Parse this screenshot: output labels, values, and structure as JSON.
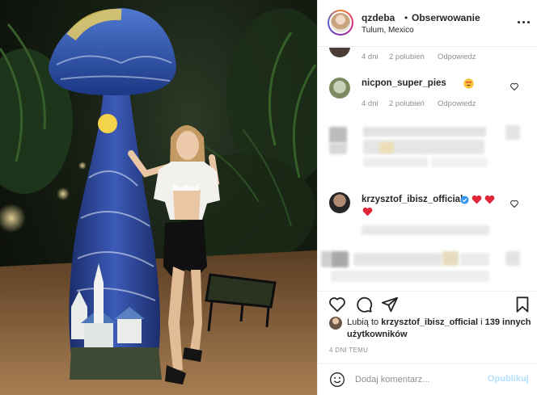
{
  "post": {
    "username": "qzdeba",
    "separator": "•",
    "follow_label": "Obserwowanie",
    "location": "Tulum, Mexico"
  },
  "comments": [
    {
      "meta": {
        "age": "4 dni",
        "likes": "2 polubień",
        "reply": "Odpowiedz"
      }
    },
    {
      "username": "nicpon_super_pies",
      "emoji": "heart-eyes-emoji",
      "meta": {
        "age": "4 dni",
        "likes": "2 polubień",
        "reply": "Odpowiedz"
      }
    },
    {
      "username": "krzysztof_ibisz_official",
      "verified": true,
      "emoji": "red-hearts"
    }
  ],
  "likes": {
    "prefix": "Lubią to",
    "user": "krzysztof_ibisz_official",
    "connector": "i",
    "others": "139 innych użytkowników"
  },
  "date": "4 DNI TEMU",
  "comment_box": {
    "placeholder": "Dodaj komentarz...",
    "post_label": "Opublikuj"
  },
  "colors": {
    "link_blue": "#0095f6",
    "post_disabled": "#b2dffc",
    "heart_red": "#ed4956",
    "muted": "#8e8e8e"
  }
}
